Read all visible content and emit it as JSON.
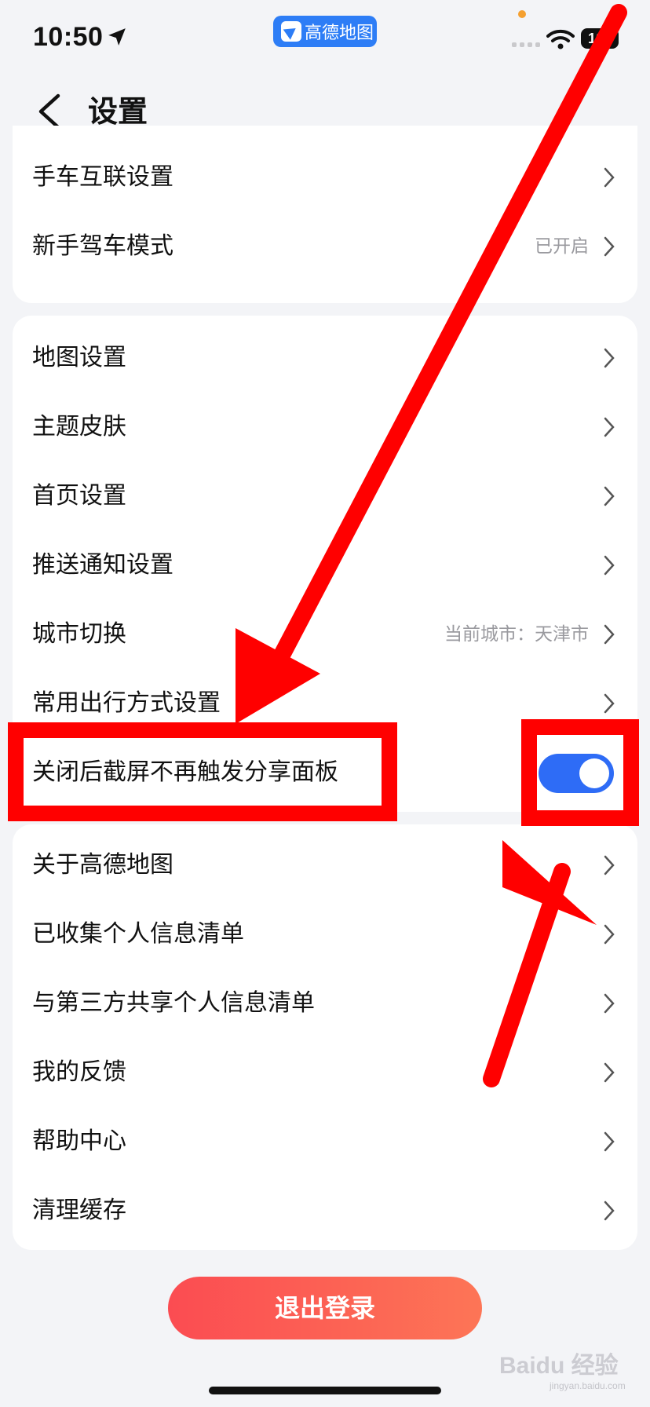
{
  "status_bar": {
    "time": "10:50",
    "app_pill_label": "高德地图",
    "battery": "100"
  },
  "header": {
    "title": "设置"
  },
  "sections": [
    {
      "items": [
        {
          "label": "手车互联设置",
          "value": ""
        },
        {
          "label": "新手驾车模式",
          "value": "已开启"
        }
      ]
    },
    {
      "items": [
        {
          "label": "地图设置",
          "value": ""
        },
        {
          "label": "主题皮肤",
          "value": ""
        },
        {
          "label": "首页设置",
          "value": ""
        },
        {
          "label": "推送通知设置",
          "value": ""
        },
        {
          "label": "城市切换",
          "value": "当前城市：天津市"
        },
        {
          "label": "常用出行方式设置",
          "value": ""
        },
        {
          "label": "关闭后截屏不再触发分享面板",
          "toggle_on": true
        }
      ]
    },
    {
      "items": [
        {
          "label": "关于高德地图",
          "value": ""
        },
        {
          "label": "已收集个人信息清单",
          "value": ""
        },
        {
          "label": "与第三方共享个人信息清单",
          "value": ""
        },
        {
          "label": "我的反馈",
          "value": ""
        },
        {
          "label": "帮助中心",
          "value": ""
        },
        {
          "label": "清理缓存",
          "value": ""
        }
      ]
    }
  ],
  "logout_label": "退出登录",
  "watermark": {
    "brand": "Baidu 经验",
    "url": "jingyan.baidu.com"
  },
  "colors": {
    "accent_blue": "#2e6cf6",
    "annotation_red": "#ff0000",
    "logout_start": "#fb4c52",
    "logout_end": "#fd7556"
  }
}
